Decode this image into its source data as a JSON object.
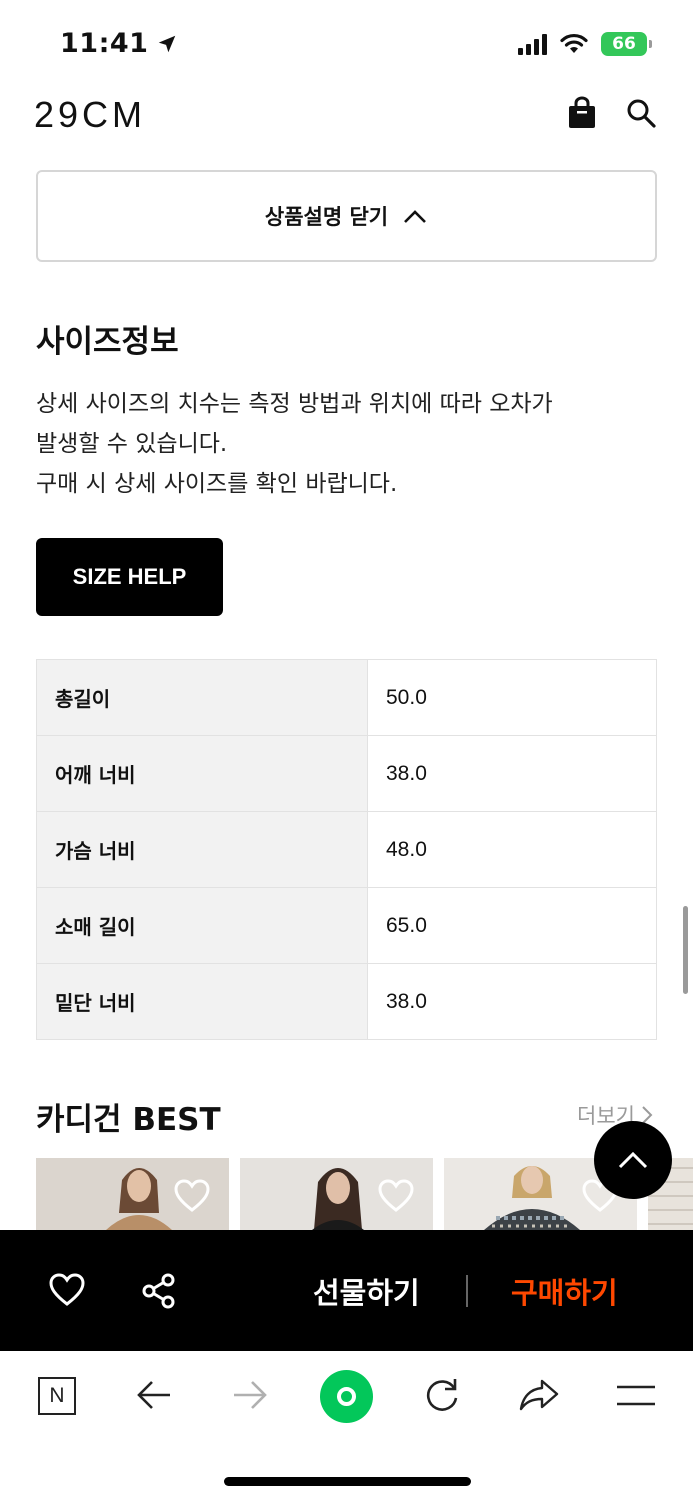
{
  "status_bar": {
    "time": "11:41",
    "battery": "66"
  },
  "header": {
    "logo": "29CM"
  },
  "description_toggle": {
    "label": "상품설명 닫기"
  },
  "size_info": {
    "title": "사이즈정보",
    "desc_lines": [
      "상세 사이즈의 치수는 측정 방법과 위치에 따라 오차가",
      "발생할 수 있습니다.",
      "구매 시 상세 사이즈를 확인 바랍니다."
    ],
    "size_help_label": "SIZE HELP",
    "rows": [
      {
        "label": "총길이",
        "value": "50.0"
      },
      {
        "label": "어깨 너비",
        "value": "38.0"
      },
      {
        "label": "가슴 너비",
        "value": "48.0"
      },
      {
        "label": "소매 길이",
        "value": "65.0"
      },
      {
        "label": "밑단 너비",
        "value": "38.0"
      }
    ]
  },
  "best": {
    "title": "카디건 BEST",
    "more_label": "더보기"
  },
  "purchase_bar": {
    "gift_label": "선물하기",
    "buy_label": "구매하기"
  },
  "colors": {
    "buy_accent": "#ff4800",
    "naver_green": "#03c75a",
    "battery_green": "#33c759"
  },
  "toolbar": {
    "n_label": "N"
  }
}
